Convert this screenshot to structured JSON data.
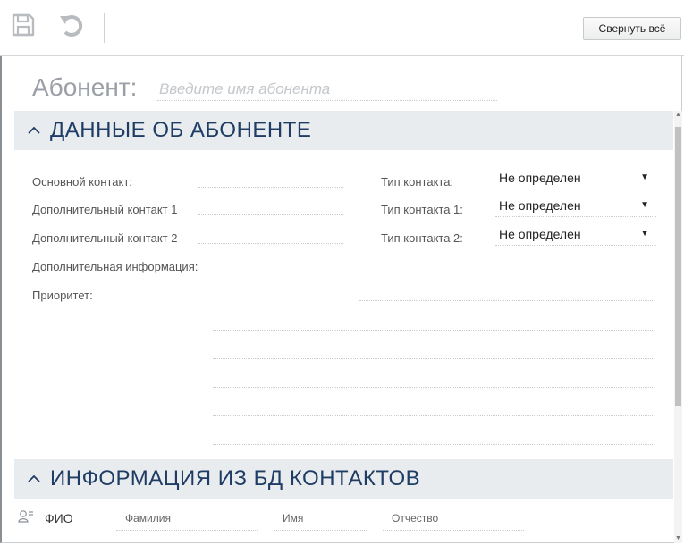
{
  "toolbar": {
    "save_icon": "save-icon",
    "undo_icon": "undo-icon",
    "collapse_all": "Свернуть всё"
  },
  "subscriber": {
    "label": "Абонент:",
    "placeholder": "Введите имя абонента"
  },
  "section1": {
    "title": "ДАННЫЕ ОБ АБОНЕНТЕ",
    "primary_contact": "Основной контакт:",
    "additional_contact_1": "Дополнительный контакт 1",
    "additional_contact_2": "Дополнительный контакт 2",
    "additional_info": "Дополнительная информация:",
    "priority": "Приоритет:",
    "contact_type": "Тип контакта:",
    "contact_type_1": "Тип контакта 1:",
    "contact_type_2": "Тип контакта 2:",
    "contact_type_value": "Не определен",
    "contact_type_1_value": "Не определен",
    "contact_type_2_value": "Не определен"
  },
  "section2": {
    "title": "ИНФОРМАЦИЯ ИЗ БД КОНТАКТОВ",
    "fio_label": "ФИО",
    "last_name": "Фамилия",
    "first_name": "Имя",
    "patronymic": "Отчество"
  },
  "colors": {
    "section_bg": "#e9ecef",
    "section_title": "#1f3d64",
    "muted": "#9aa0a6"
  }
}
